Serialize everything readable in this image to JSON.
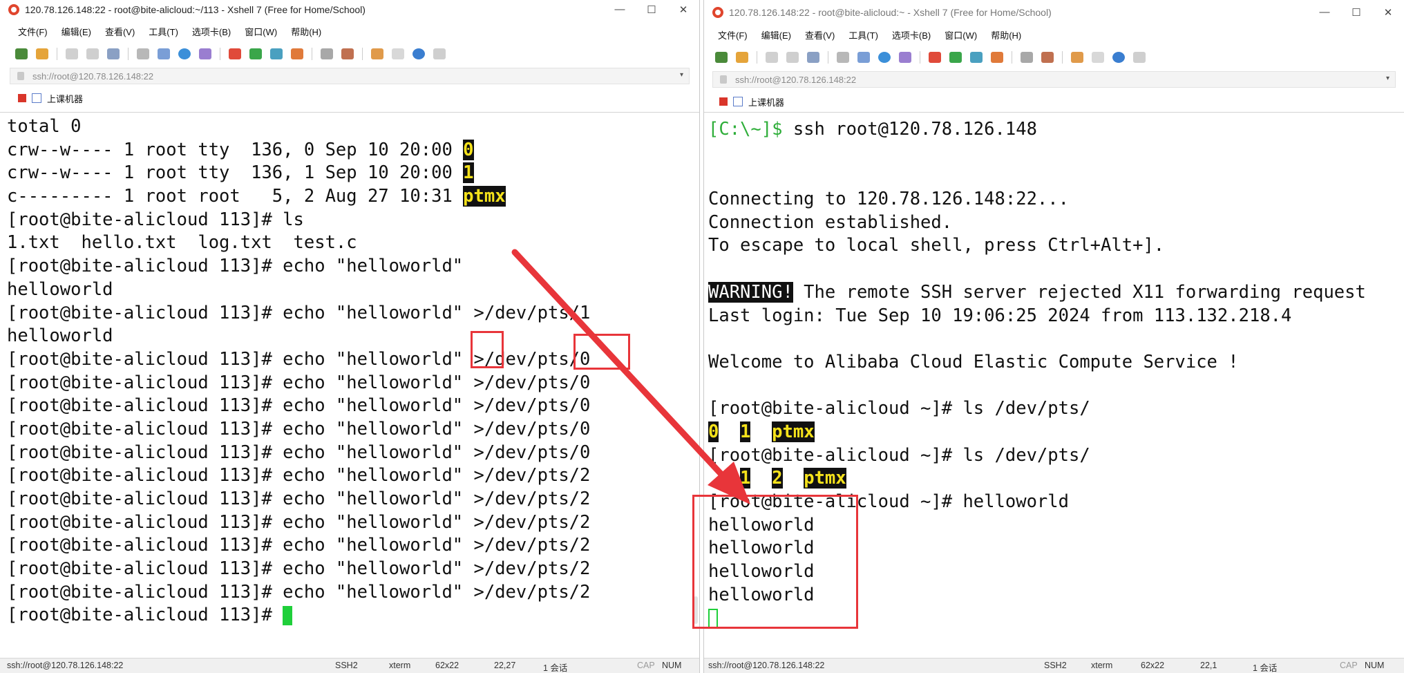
{
  "left_window": {
    "title": "120.78.126.148:22 - root@bite-alicloud:~/113 - Xshell 7 (Free for Home/School)",
    "controls": {
      "minimize": "—",
      "maximize": "☐",
      "close": "✕"
    },
    "menu": [
      "文件(F)",
      "编辑(E)",
      "查看(V)",
      "工具(T)",
      "选项卡(B)",
      "窗口(W)",
      "帮助(H)"
    ],
    "address": "ssh://root@120.78.126.148:22",
    "bookmark": "上课机器",
    "terminal_lines": [
      {
        "text": "total 0"
      },
      {
        "text": "crw--w---- 1 root tty  136, 0 Sep 10 20:00 ",
        "hl": "0"
      },
      {
        "text": "crw--w---- 1 root tty  136, 1 Sep 10 20:00 ",
        "hl": "1"
      },
      {
        "text": "c--------- 1 root root   5, 2 Aug 27 10:31 ",
        "hl": "ptmx"
      },
      {
        "text": "[root@bite-alicloud 113]# ls"
      },
      {
        "text": "1.txt  hello.txt  log.txt  test.c"
      },
      {
        "text": "[root@bite-alicloud 113]# echo \"helloworld\""
      },
      {
        "text": "helloworld"
      },
      {
        "text": "[root@bite-alicloud 113]# echo \"helloworld\" >/dev/pts/1"
      },
      {
        "text": "helloworld"
      },
      {
        "text": "[root@bite-alicloud 113]# echo \"helloworld\" >/dev/pts/0"
      },
      {
        "text": "[root@bite-alicloud 113]# echo \"helloworld\" >/dev/pts/0"
      },
      {
        "text": "[root@bite-alicloud 113]# echo \"helloworld\" >/dev/pts/0"
      },
      {
        "text": "[root@bite-alicloud 113]# echo \"helloworld\" >/dev/pts/0"
      },
      {
        "text": "[root@bite-alicloud 113]# echo \"helloworld\" >/dev/pts/0"
      },
      {
        "text": "[root@bite-alicloud 113]# echo \"helloworld\" >/dev/pts/2"
      },
      {
        "text": "[root@bite-alicloud 113]# echo \"helloworld\" >/dev/pts/2"
      },
      {
        "text": "[root@bite-alicloud 113]# echo \"helloworld\" >/dev/pts/2"
      },
      {
        "text": "[root@bite-alicloud 113]# echo \"helloworld\" >/dev/pts/2"
      },
      {
        "text": "[root@bite-alicloud 113]# echo \"helloworld\" >/dev/pts/2"
      },
      {
        "text": "[root@bite-alicloud 113]# echo \"helloworld\" >/dev/pts/2"
      },
      {
        "text": "[root@bite-alicloud 113]# ",
        "cursor": true
      }
    ],
    "status": {
      "connection": "ssh://root@120.78.126.148:22",
      "protocol": "SSH2",
      "term": "xterm",
      "size": "62x22",
      "position": "22,27",
      "sessions": "1 会话",
      "caps": "CAP",
      "num": "NUM"
    }
  },
  "right_window": {
    "title": "120.78.126.148:22 - root@bite-alicloud:~ - Xshell 7 (Free for Home/School)",
    "controls": {
      "minimize": "—",
      "maximize": "☐",
      "close": "✕"
    },
    "menu": [
      "文件(F)",
      "编辑(E)",
      "查看(V)",
      "工具(T)",
      "选项卡(B)",
      "窗口(W)",
      "帮助(H)"
    ],
    "address": "ssh://root@120.78.126.148:22",
    "bookmark": "上课机器",
    "terminal_lines": [
      {
        "prompt": "[C:\\~]$",
        "text": " ssh root@120.78.126.148"
      },
      {
        "text": ""
      },
      {
        "text": ""
      },
      {
        "text": "Connecting to 120.78.126.148:22..."
      },
      {
        "text": "Connection established."
      },
      {
        "text": "To escape to local shell, press Ctrl+Alt+]."
      },
      {
        "text": ""
      },
      {
        "warn": "WARNING!",
        "text": " The remote SSH server rejected X11 forwarding request"
      },
      {
        "text": "Last login: Tue Sep 10 19:06:25 2024 from 113.132.218.4"
      },
      {
        "text": ""
      },
      {
        "text": "Welcome to Alibaba Cloud Elastic Compute Service !"
      },
      {
        "text": ""
      },
      {
        "text": "[root@bite-alicloud ~]# ls /dev/pts/"
      },
      {
        "hl_items": [
          "0",
          "1",
          "ptmx"
        ]
      },
      {
        "text": "[root@bite-alicloud ~]# ls /dev/pts/"
      },
      {
        "hl_items": [
          "1",
          "2",
          "ptmx"
        ],
        "indent": true
      },
      {
        "text": "[root@bite-alicloud ~]# helloworld"
      },
      {
        "text": "helloworld"
      },
      {
        "text": "helloworld"
      },
      {
        "text": "helloworld"
      },
      {
        "text": "helloworld"
      },
      {
        "cursor_outline": true
      }
    ],
    "status": {
      "connection": "ssh://root@120.78.126.148:22",
      "protocol": "SSH2",
      "term": "xterm",
      "size": "62x22",
      "position": "22,1",
      "sessions": "1 会话",
      "caps": "CAP",
      "num": "NUM"
    }
  },
  "colors": {
    "highlight_bg": "#111111",
    "highlight_fg": "#f5e21b",
    "annotation": "#e8353a",
    "cursor": "#1fcf3a",
    "prompt_local": "#2fae3a"
  }
}
